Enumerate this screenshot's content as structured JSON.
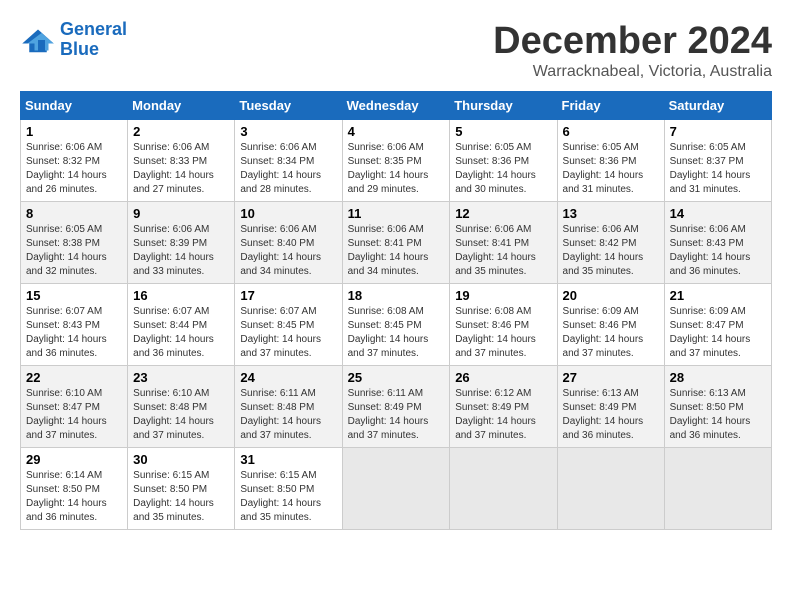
{
  "logo": {
    "line1": "General",
    "line2": "Blue"
  },
  "title": "December 2024",
  "location": "Warracknabeal, Victoria, Australia",
  "days_of_week": [
    "Sunday",
    "Monday",
    "Tuesday",
    "Wednesday",
    "Thursday",
    "Friday",
    "Saturday"
  ],
  "weeks": [
    [
      {
        "day": "1",
        "sunrise": "6:06 AM",
        "sunset": "8:32 PM",
        "daylight": "14 hours and 26 minutes."
      },
      {
        "day": "2",
        "sunrise": "6:06 AM",
        "sunset": "8:33 PM",
        "daylight": "14 hours and 27 minutes."
      },
      {
        "day": "3",
        "sunrise": "6:06 AM",
        "sunset": "8:34 PM",
        "daylight": "14 hours and 28 minutes."
      },
      {
        "day": "4",
        "sunrise": "6:06 AM",
        "sunset": "8:35 PM",
        "daylight": "14 hours and 29 minutes."
      },
      {
        "day": "5",
        "sunrise": "6:05 AM",
        "sunset": "8:36 PM",
        "daylight": "14 hours and 30 minutes."
      },
      {
        "day": "6",
        "sunrise": "6:05 AM",
        "sunset": "8:36 PM",
        "daylight": "14 hours and 31 minutes."
      },
      {
        "day": "7",
        "sunrise": "6:05 AM",
        "sunset": "8:37 PM",
        "daylight": "14 hours and 31 minutes."
      }
    ],
    [
      {
        "day": "8",
        "sunrise": "6:05 AM",
        "sunset": "8:38 PM",
        "daylight": "14 hours and 32 minutes."
      },
      {
        "day": "9",
        "sunrise": "6:06 AM",
        "sunset": "8:39 PM",
        "daylight": "14 hours and 33 minutes."
      },
      {
        "day": "10",
        "sunrise": "6:06 AM",
        "sunset": "8:40 PM",
        "daylight": "14 hours and 34 minutes."
      },
      {
        "day": "11",
        "sunrise": "6:06 AM",
        "sunset": "8:41 PM",
        "daylight": "14 hours and 34 minutes."
      },
      {
        "day": "12",
        "sunrise": "6:06 AM",
        "sunset": "8:41 PM",
        "daylight": "14 hours and 35 minutes."
      },
      {
        "day": "13",
        "sunrise": "6:06 AM",
        "sunset": "8:42 PM",
        "daylight": "14 hours and 35 minutes."
      },
      {
        "day": "14",
        "sunrise": "6:06 AM",
        "sunset": "8:43 PM",
        "daylight": "14 hours and 36 minutes."
      }
    ],
    [
      {
        "day": "15",
        "sunrise": "6:07 AM",
        "sunset": "8:43 PM",
        "daylight": "14 hours and 36 minutes."
      },
      {
        "day": "16",
        "sunrise": "6:07 AM",
        "sunset": "8:44 PM",
        "daylight": "14 hours and 36 minutes."
      },
      {
        "day": "17",
        "sunrise": "6:07 AM",
        "sunset": "8:45 PM",
        "daylight": "14 hours and 37 minutes."
      },
      {
        "day": "18",
        "sunrise": "6:08 AM",
        "sunset": "8:45 PM",
        "daylight": "14 hours and 37 minutes."
      },
      {
        "day": "19",
        "sunrise": "6:08 AM",
        "sunset": "8:46 PM",
        "daylight": "14 hours and 37 minutes."
      },
      {
        "day": "20",
        "sunrise": "6:09 AM",
        "sunset": "8:46 PM",
        "daylight": "14 hours and 37 minutes."
      },
      {
        "day": "21",
        "sunrise": "6:09 AM",
        "sunset": "8:47 PM",
        "daylight": "14 hours and 37 minutes."
      }
    ],
    [
      {
        "day": "22",
        "sunrise": "6:10 AM",
        "sunset": "8:47 PM",
        "daylight": "14 hours and 37 minutes."
      },
      {
        "day": "23",
        "sunrise": "6:10 AM",
        "sunset": "8:48 PM",
        "daylight": "14 hours and 37 minutes."
      },
      {
        "day": "24",
        "sunrise": "6:11 AM",
        "sunset": "8:48 PM",
        "daylight": "14 hours and 37 minutes."
      },
      {
        "day": "25",
        "sunrise": "6:11 AM",
        "sunset": "8:49 PM",
        "daylight": "14 hours and 37 minutes."
      },
      {
        "day": "26",
        "sunrise": "6:12 AM",
        "sunset": "8:49 PM",
        "daylight": "14 hours and 37 minutes."
      },
      {
        "day": "27",
        "sunrise": "6:13 AM",
        "sunset": "8:49 PM",
        "daylight": "14 hours and 36 minutes."
      },
      {
        "day": "28",
        "sunrise": "6:13 AM",
        "sunset": "8:50 PM",
        "daylight": "14 hours and 36 minutes."
      }
    ],
    [
      {
        "day": "29",
        "sunrise": "6:14 AM",
        "sunset": "8:50 PM",
        "daylight": "14 hours and 36 minutes."
      },
      {
        "day": "30",
        "sunrise": "6:15 AM",
        "sunset": "8:50 PM",
        "daylight": "14 hours and 35 minutes."
      },
      {
        "day": "31",
        "sunrise": "6:15 AM",
        "sunset": "8:50 PM",
        "daylight": "14 hours and 35 minutes."
      },
      null,
      null,
      null,
      null
    ]
  ]
}
